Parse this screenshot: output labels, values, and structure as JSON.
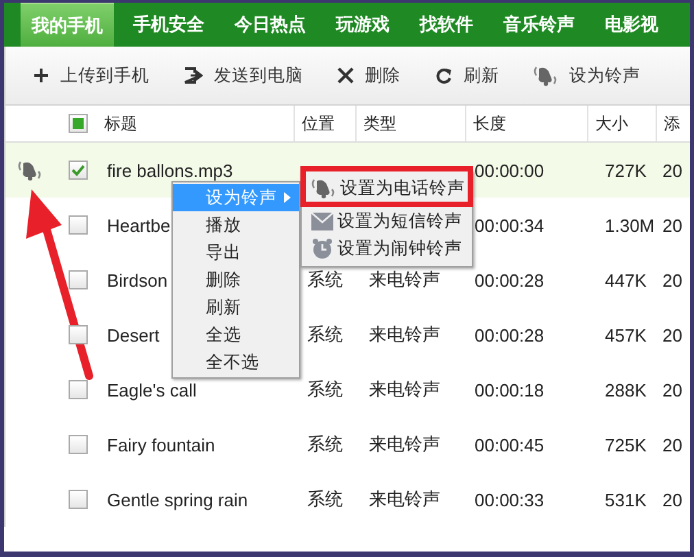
{
  "tabs": [
    {
      "label": "我的手机",
      "selected": true
    },
    {
      "label": "手机安全",
      "selected": false
    },
    {
      "label": "今日热点",
      "selected": false
    },
    {
      "label": "玩游戏",
      "selected": false
    },
    {
      "label": "找软件",
      "selected": false
    },
    {
      "label": "音乐铃声",
      "selected": false
    },
    {
      "label": "电影视",
      "selected": false
    }
  ],
  "toolbar": [
    {
      "kind": "plus",
      "label": "上传到手机"
    },
    {
      "kind": "send",
      "label": "发送到电脑"
    },
    {
      "kind": "delete",
      "label": "删除"
    },
    {
      "kind": "refresh",
      "label": "刷新"
    },
    {
      "kind": "ringtone",
      "label": "设为铃声"
    }
  ],
  "table": {
    "header_checkbox": {
      "indeterminate": true
    },
    "columns": [
      "标题",
      "位置",
      "类型",
      "长度",
      "大小",
      "添"
    ],
    "rows": [
      {
        "ringtone": true,
        "selected": true,
        "checked": true,
        "title": "fire ballons.mp3",
        "length": "00:00:00",
        "size": "727K",
        "added": "20"
      },
      {
        "ringtone": false,
        "selected": false,
        "checked": false,
        "title": "Heartbe",
        "length": "00:00:34",
        "size": "1.30M",
        "added": "20"
      },
      {
        "ringtone": false,
        "selected": false,
        "checked": false,
        "title": "Birdson",
        "location": "系统",
        "type": "来电铃声",
        "length": "00:00:28",
        "size": "447K",
        "added": "20"
      },
      {
        "ringtone": false,
        "selected": false,
        "checked": false,
        "title": "Desert",
        "location": "系统",
        "type": "来电铃声",
        "length": "00:00:28",
        "size": "457K",
        "added": "20"
      },
      {
        "ringtone": false,
        "selected": false,
        "checked": false,
        "title": "Eagle's call",
        "location": "系统",
        "type": "来电铃声",
        "length": "00:00:18",
        "size": "288K",
        "added": "20"
      },
      {
        "ringtone": false,
        "selected": false,
        "checked": false,
        "title": "Fairy fountain",
        "location": "系统",
        "type": "来电铃声",
        "length": "00:00:45",
        "size": "725K",
        "added": "20"
      },
      {
        "ringtone": false,
        "selected": false,
        "checked": false,
        "title": "Gentle spring rain",
        "location": "系统",
        "type": "来电铃声",
        "length": "00:00:33",
        "size": "531K",
        "added": "20"
      }
    ]
  },
  "context_menu": {
    "items": [
      {
        "label": "设为铃声",
        "highlighted": true,
        "has_submenu": true
      },
      {
        "label": "播放",
        "highlighted": false,
        "has_submenu": false
      },
      {
        "label": "导出",
        "highlighted": false,
        "has_submenu": false
      },
      {
        "label": "删除",
        "highlighted": false,
        "has_submenu": false
      },
      {
        "label": "刷新",
        "highlighted": false,
        "has_submenu": false
      },
      {
        "label": "全选",
        "highlighted": false,
        "has_submenu": false
      },
      {
        "label": "全不选",
        "highlighted": false,
        "has_submenu": false
      }
    ]
  },
  "submenu": {
    "items": [
      {
        "kind": "phone",
        "label": "设置为电话铃声"
      },
      {
        "kind": "sms",
        "label": "设置为短信铃声"
      },
      {
        "kind": "alarm",
        "label": "设置为闹钟铃声"
      }
    ]
  },
  "annotations": {
    "highlight_box": true,
    "arrow": true
  }
}
